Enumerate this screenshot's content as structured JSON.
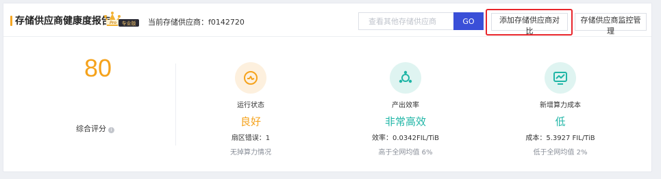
{
  "header": {
    "title": "存储供应商健康度报告",
    "badge_text": "专业版",
    "current_provider_label": "当前存储供应商：",
    "current_provider_id": "f0142720",
    "search_placeholder": "查看其他存储供应商",
    "go_label": "GO",
    "compare_label": "添加存储供应商对比",
    "monitor_label": "存储供应商监控管理"
  },
  "summary": {
    "score": "80",
    "score_label": "综合评分",
    "score_color": "#f5a21b"
  },
  "metrics": [
    {
      "name": "运行状态",
      "status": "良好",
      "detail": "扇区错误：1",
      "sub": "无掉算力情况",
      "icon": "speedometer-icon",
      "status_color": "#f5a21b",
      "icon_bg": "#fdf0de"
    },
    {
      "name": "产出效率",
      "status": "非常高效",
      "detail": "效率：0.0342FIL/TiB",
      "sub": "高于全网均值 6%",
      "icon": "network-icon",
      "status_color": "#1fb5a6",
      "icon_bg": "#dff4f1"
    },
    {
      "name": "新增算力成本",
      "status": "低",
      "detail": "成本：5.3927 FIL/TiB",
      "sub": "低于全网均值 2%",
      "icon": "trend-chart-icon",
      "status_color": "#1fb5a6",
      "icon_bg": "#dff4f1"
    }
  ],
  "colors": {
    "accent_blue": "#3a4fd8",
    "highlight_red": "#e8242a",
    "title_bar": "#f5a623"
  }
}
